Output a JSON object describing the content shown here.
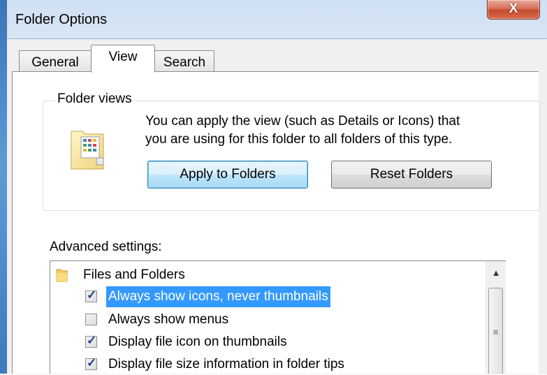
{
  "window": {
    "title": "Folder Options",
    "close_glyph": "X"
  },
  "tabs": [
    {
      "label": "General",
      "active": false
    },
    {
      "label": "View",
      "active": true
    },
    {
      "label": "Search",
      "active": false
    }
  ],
  "folder_views": {
    "legend": "Folder views",
    "description": "You can apply the view (such as Details or Icons) that\nyou are using for this folder to all folders of this type.",
    "apply_button": "Apply to Folders",
    "reset_button": "Reset Folders",
    "icon": "folder-views-icon"
  },
  "advanced": {
    "label": "Advanced settings:",
    "category": "Files and Folders",
    "items": [
      {
        "label": "Always show icons, never thumbnails",
        "checked": true,
        "selected": true
      },
      {
        "label": "Always show menus",
        "checked": false,
        "selected": false
      },
      {
        "label": "Display file icon on thumbnails",
        "checked": true,
        "selected": false
      },
      {
        "label": "Display file size information in folder tips",
        "checked": true,
        "selected": false
      }
    ],
    "scroll_up_glyph": "▲",
    "thumb_grip_glyph": "≡"
  },
  "colors": {
    "selection": "#3399ff",
    "close_button": "#c44a2e",
    "default_button_border": "#3c7fb1"
  }
}
